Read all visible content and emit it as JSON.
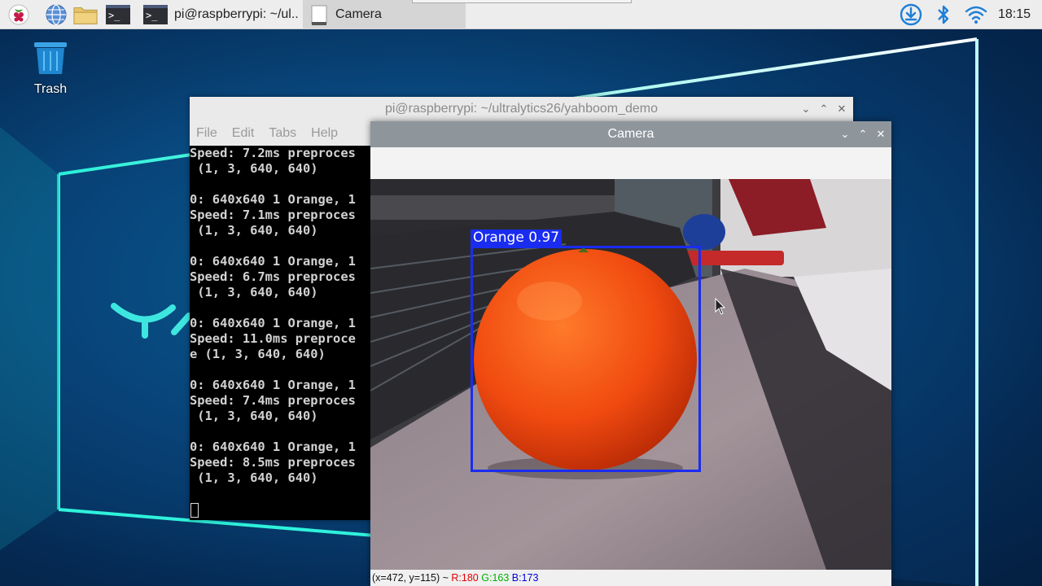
{
  "taskbar": {
    "tasks": [
      {
        "label": "pi@raspberrypi: ~/ul..",
        "active": false
      },
      {
        "label": "Camera",
        "active": true
      }
    ],
    "clock": "18:15",
    "launchers": [
      "raspberry-menu-icon",
      "web-browser-icon",
      "file-manager-icon",
      "terminal-icon"
    ],
    "tray": [
      "download-icon",
      "bluetooth-icon",
      "wifi-icon"
    ]
  },
  "desktop": {
    "trash_label": "Trash"
  },
  "terminal": {
    "title": "pi@raspberrypi: ~/ultralytics26/yahboom_demo",
    "menu": [
      "File",
      "Edit",
      "Tabs",
      "Help"
    ],
    "lines": [
      "Speed: 7.2ms preproces",
      " (1, 3, 640, 640)",
      "",
      "0: 640x640 1 Orange, 1",
      "Speed: 7.1ms preproces",
      " (1, 3, 640, 640)",
      "",
      "0: 640x640 1 Orange, 1",
      "Speed: 6.7ms preproces",
      " (1, 3, 640, 640)",
      "",
      "0: 640x640 1 Orange, 1",
      "Speed: 11.0ms preproce",
      "e (1, 3, 640, 640)",
      "",
      "0: 640x640 1 Orange, 1",
      "Speed: 7.4ms preproces",
      " (1, 3, 640, 640)",
      "",
      "0: 640x640 1 Orange, 1",
      "Speed: 8.5ms preproces",
      " (1, 3, 640, 640)"
    ]
  },
  "camera": {
    "title": "Camera",
    "detection": {
      "label": "Orange 0.97",
      "color": "#1a2cf0"
    },
    "status": {
      "coords": "(x=472, y=115) ~ ",
      "r": "R:180",
      "g": "G:163",
      "b": "B:173"
    }
  },
  "colors": {
    "taskbar_bg": "#ededed",
    "camera_titlebar": "#8e969c",
    "status_r": "#e00000",
    "status_g": "#00b000",
    "status_b": "#0000e0"
  }
}
